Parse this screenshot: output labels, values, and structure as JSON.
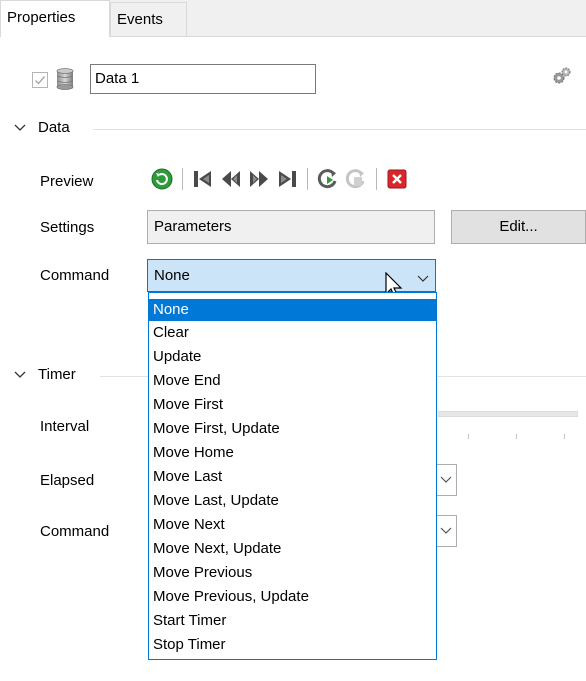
{
  "tabs": [
    {
      "label": "Properties",
      "active": true
    },
    {
      "label": "Events",
      "active": false
    }
  ],
  "header": {
    "enabled_checked": true,
    "name_value": "Data 1"
  },
  "data_section": {
    "title": "Data",
    "preview_label": "Preview",
    "settings_label": "Settings",
    "settings_value": "Parameters",
    "edit_button": "Edit...",
    "command_label": "Command",
    "command_value": "None",
    "command_options": [
      "None",
      "Clear",
      "Update",
      "Move End",
      "Move First",
      "Move First, Update",
      "Move Home",
      "Move Last",
      "Move Last, Update",
      "Move Next",
      "Move Next, Update",
      "Move Previous",
      "Move Previous, Update",
      "Start Timer",
      "Stop Timer"
    ]
  },
  "timer_section": {
    "title": "Timer",
    "interval_label": "Interval",
    "elapsed_label": "Elapsed",
    "command_label": "Command"
  },
  "toolbar_icons": [
    "refresh-icon",
    "first-record-icon",
    "previous-record-icon",
    "next-record-icon",
    "last-record-icon",
    "apply-icon",
    "cancel-edit-icon",
    "delete-icon"
  ],
  "colors": {
    "accent": "#0078d7",
    "selection": "#cce4f7",
    "delete_red": "#d9262b",
    "refresh_green": "#2e9b3a"
  }
}
